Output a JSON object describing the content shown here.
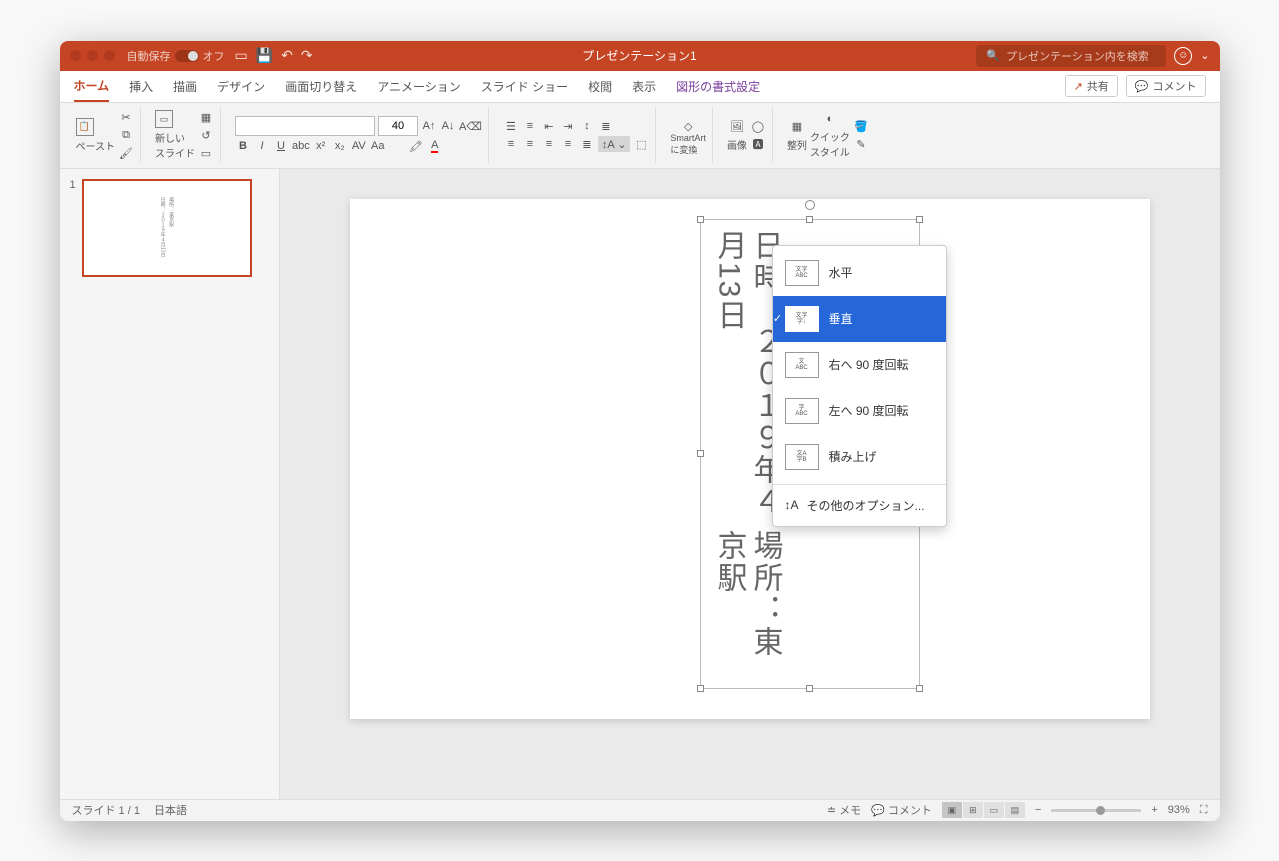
{
  "titlebar": {
    "autosave_label": "自動保存",
    "autosave_state": "オフ",
    "title": "プレゼンテーション1",
    "search_placeholder": "プレゼンテーション内を検索"
  },
  "tabs": {
    "home": "ホーム",
    "insert": "挿入",
    "draw": "描画",
    "design": "デザイン",
    "transitions": "画面切り替え",
    "animations": "アニメーション",
    "slideshow": "スライド ショー",
    "review": "校閲",
    "view": "表示",
    "shape_format": "図形の書式設定",
    "share": "共有",
    "comment": "コメント"
  },
  "ribbon": {
    "paste": "ペースト",
    "new_slide": "新しい\nスライド",
    "font_size": "40",
    "smartart": "SmartArt\nに変換",
    "image": "画像",
    "arrange": "整列",
    "quickstyle": "クイック\nスタイル"
  },
  "dropdown": {
    "horizontal": "水平",
    "vertical": "垂直",
    "rotate_right_90": "右へ 90 度回転",
    "rotate_left_90": "左へ 90 度回転",
    "stacked": "積み上げ",
    "more_options": "その他のオプション..."
  },
  "slide_content": {
    "line1": "日時：２０１９年４月13日",
    "line2": "場所：東京駅"
  },
  "thumb": {
    "line1": "日時：２０１９年４月13日",
    "line2": "場所：東京駅"
  },
  "statusbar": {
    "slide_count": "スライド 1 / 1",
    "language": "日本語",
    "notes": "メモ",
    "comments": "コメント",
    "zoom": "93%"
  }
}
